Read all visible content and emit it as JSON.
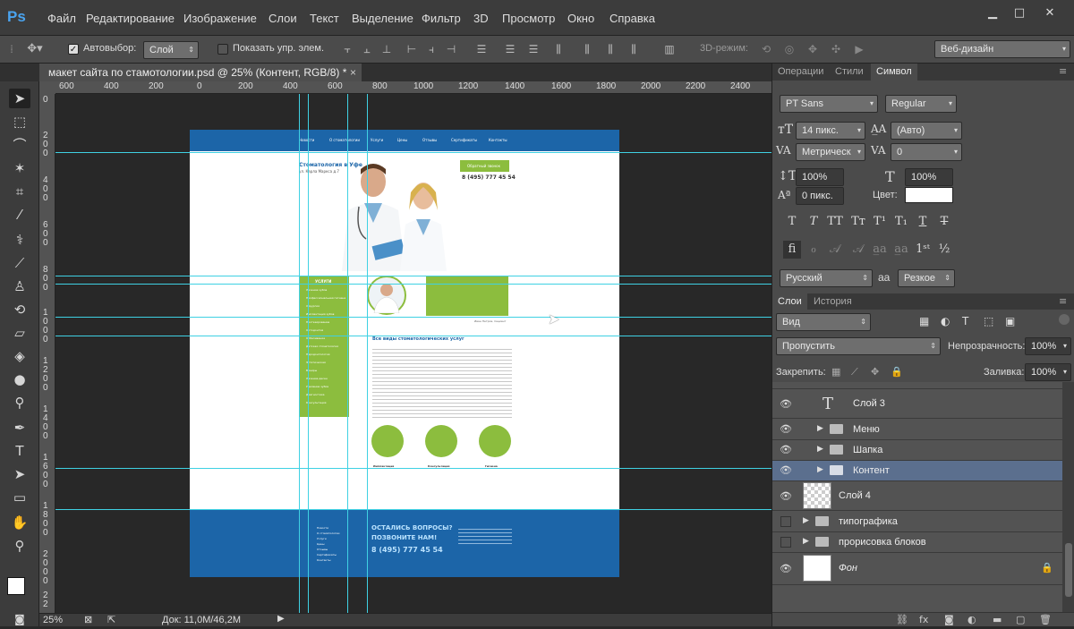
{
  "app": {
    "logo": "Ps"
  },
  "menubar": {
    "items": [
      "Файл",
      "Редактирование",
      "Изображение",
      "Слои",
      "Текст",
      "Выделение",
      "Фильтр",
      "3D",
      "Просмотр",
      "Окно",
      "Справка"
    ],
    "win_min": "▁",
    "win_max": "□",
    "win_close": "✕"
  },
  "options": {
    "autoselect_label": "Автовыбор:",
    "autoselect_value": "Слой",
    "show_controls_label": "Показать упр. элем.",
    "mode3d_label": "3D-режим:",
    "workspace": "Веб-дизайн"
  },
  "document": {
    "tab_title": "макет сайта по стамотологии.psd @ 25% (Контент, RGB/8) *",
    "close": "×",
    "ruler_top": [
      "600",
      "400",
      "200",
      "0",
      "200",
      "400",
      "600",
      "800",
      "1000",
      "1200",
      "1400",
      "1600",
      "1800",
      "2000",
      "2200",
      "2400"
    ],
    "ruler_left": [
      "0",
      "2",
      "0",
      "0",
      "4",
      "0",
      "0",
      "6",
      "0",
      "0",
      "8",
      "0",
      "0",
      "1",
      "0",
      "0",
      "0",
      "1",
      "2",
      "0",
      "0",
      "1",
      "4",
      "0",
      "0",
      "1",
      "6",
      "0",
      "0",
      "1",
      "8",
      "0",
      "0",
      "2",
      "0",
      "0",
      "0",
      "2",
      "2",
      "0",
      "0"
    ]
  },
  "mockup": {
    "nav": [
      "Новости",
      "О стоматологии",
      "Услуги",
      "Цены",
      "Отзывы",
      "Сертификаты",
      "Контакты"
    ],
    "clinic_name": "Стоматология в Уфе",
    "clinic_address": "ул. Карла Маркса д.7",
    "callback_button": "Обратный звонок",
    "phone": "8 (495) 777 45 54",
    "sidebar_title": "УСЛУГИ",
    "sidebar_items": [
      "Лечение зубов",
      "Профессиональная гигиена",
      "Хирургия",
      "Имплантация зубов",
      "Протезирование",
      "Ортодонтия",
      "Отбеливание",
      "Детская стоматология",
      "Пародонтология",
      "Эстетическая",
      "Виниры",
      "Лечение десен",
      "Удаление зубов",
      "Диагностика",
      "Консультация"
    ],
    "review_author": "Иван Петров, пациент",
    "section_title": "Все виды стоматологических услуг",
    "features": [
      "Имплантация",
      "Консультация",
      "Гигиена"
    ],
    "footer_heading_1": "ОСТАЛИСЬ ВОПРОСЫ?",
    "footer_heading_2": "ПОЗВОНИТЕ НАМ!",
    "footer_phone": "8 (495) 777 45 54",
    "footer_links": [
      "Новости",
      "О стоматологии",
      "Услуги",
      "Цены",
      "Отзывы",
      "Сертификаты",
      "Контакты"
    ]
  },
  "status": {
    "zoom": "25%",
    "doc_info": "Док: 11,0M/46,2M"
  },
  "character_panel": {
    "tabs": [
      "Операции",
      "Стили",
      "Символ"
    ],
    "font_family": "PT Sans",
    "font_style": "Regular",
    "size": "14 пикс.",
    "leading": "(Авто)",
    "kerning": "Метрическ",
    "tracking": "0",
    "vscale": "100%",
    "hscale": "100%",
    "baseline": "0 пикс.",
    "color_label": "Цвет:",
    "language": "Русский",
    "aa_label": "aa",
    "antialias": "Резкое"
  },
  "layers_panel": {
    "tabs": [
      "Слои",
      "История"
    ],
    "filter": "Вид",
    "blend": "Пропустить",
    "opacity_label": "Непрозрачность:",
    "opacity": "100%",
    "lock_label": "Закрепить:",
    "fill_label": "Заливка:",
    "fill": "100%",
    "layers": [
      {
        "name": "Слой 3"
      },
      {
        "name": "Меню"
      },
      {
        "name": "Шапка"
      },
      {
        "name": "Контент"
      },
      {
        "name": "Слой 4"
      },
      {
        "name": "типографика"
      },
      {
        "name": "прорисовка блоков"
      },
      {
        "name": "Фон"
      }
    ]
  },
  "colors": {
    "accent_green": "#8cbd3e",
    "site_blue": "#1c65a8",
    "guide": "#3fd1e3",
    "layer_selected": "#5b6f8e"
  }
}
